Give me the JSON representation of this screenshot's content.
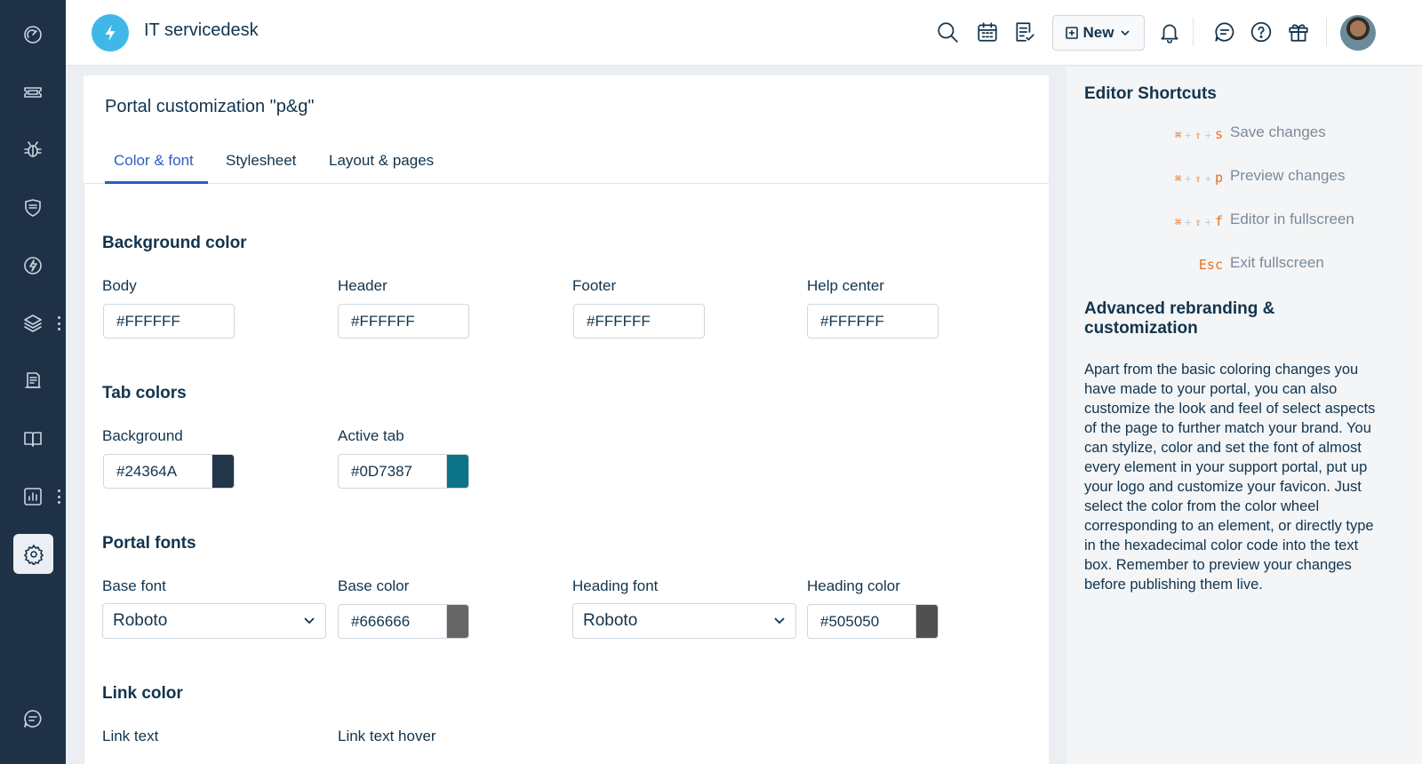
{
  "app": {
    "title": "IT servicedesk"
  },
  "sidebar": {
    "items": [
      {
        "icon": "dashboard-icon"
      },
      {
        "icon": "tickets-icon"
      },
      {
        "icon": "problems-bug-icon"
      },
      {
        "icon": "changes-shield-icon"
      },
      {
        "icon": "releases-bolt-icon"
      },
      {
        "icon": "assets-layers-icon"
      },
      {
        "icon": "contracts-icon"
      },
      {
        "icon": "solutions-book-icon"
      },
      {
        "icon": "reports-chart-icon"
      },
      {
        "icon": "admin-gear-icon",
        "active": true
      }
    ],
    "bottom_icon": "chat-icon"
  },
  "topbar": {
    "new_button_label": "New"
  },
  "page": {
    "title": "Portal customization \"p&g\"",
    "tabs": [
      {
        "label": "Color & font",
        "active": true
      },
      {
        "label": "Stylesheet"
      },
      {
        "label": "Layout & pages"
      }
    ]
  },
  "sections": {
    "background": {
      "title": "Background color",
      "fields": [
        {
          "label": "Body",
          "value": "#FFFFFF"
        },
        {
          "label": "Header",
          "value": "#FFFFFF"
        },
        {
          "label": "Footer",
          "value": "#FFFFFF"
        },
        {
          "label": "Help center",
          "value": "#FFFFFF"
        }
      ]
    },
    "tabs": {
      "title": "Tab colors",
      "fields": [
        {
          "label": "Background",
          "value": "#24364A",
          "swatch": "#24364A"
        },
        {
          "label": "Active tab",
          "value": "#0D7387",
          "swatch": "#0D7387"
        }
      ]
    },
    "fonts": {
      "title": "Portal fonts",
      "base_font_label": "Base font",
      "base_font_value": "Roboto",
      "base_color_label": "Base color",
      "base_color_value": "#666666",
      "base_color_swatch": "#666666",
      "heading_font_label": "Heading font",
      "heading_font_value": "Roboto",
      "heading_color_label": "Heading color",
      "heading_color_value": "#505050",
      "heading_color_swatch": "#505050"
    },
    "link": {
      "title": "Link color",
      "link_text_label": "Link text",
      "link_hover_label": "Link text hover"
    }
  },
  "right_panel": {
    "shortcuts_title": "Editor Shortcuts",
    "shortcuts": [
      {
        "mod1": "⌘",
        "mod2": "⇧",
        "key": "s",
        "label": "Save changes"
      },
      {
        "mod1": "⌘",
        "mod2": "⇧",
        "key": "p",
        "label": "Preview changes"
      },
      {
        "mod1": "⌘",
        "mod2": "⇧",
        "key": "f",
        "label": "Editor in fullscreen"
      },
      {
        "key": "Esc",
        "label": "Exit fullscreen"
      }
    ],
    "advanced_title": "Advanced rebranding & customization",
    "advanced_text": "Apart from the basic coloring changes you have made to your portal, you can also customize the look and feel of select aspects of the page to further match your brand. You can stylize, color and set the font of almost every element in your support portal, put up your logo and customize your favicon. Just select the color from the color wheel corresponding to an element, or directly type in the hexadecimal color code into the text box. Remember to preview your changes before publishing them live."
  },
  "colors": {
    "sidebar_bg": "#1E3147",
    "accent": "#2C5CC5",
    "logo": "#3FB8E8",
    "shortcut_key": "#E8701A"
  }
}
